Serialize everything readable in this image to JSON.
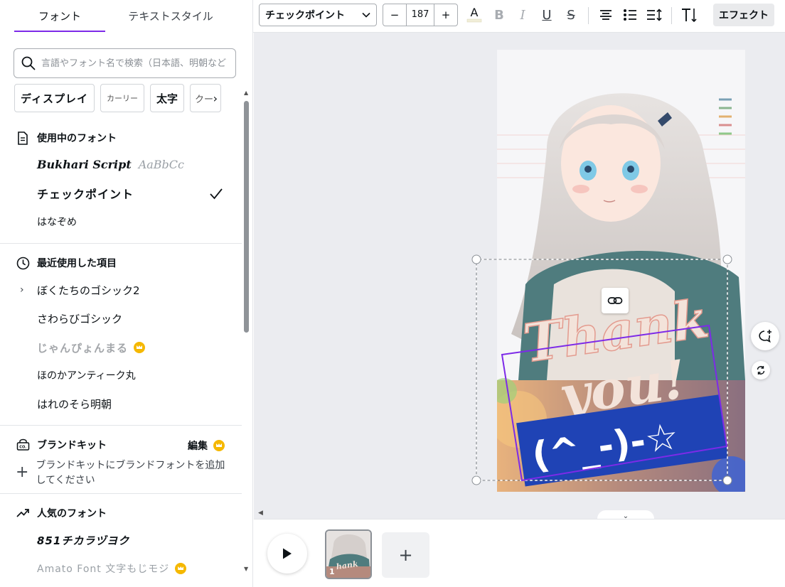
{
  "tabs": {
    "fonts": "フォント",
    "text_styles": "テキストスタイル"
  },
  "search": {
    "placeholder": "言語やフォント名で検索（日本語、明朝など）"
  },
  "chips": [
    "ディスプレイ",
    "カーリー",
    "太字",
    "クー"
  ],
  "sections": {
    "in_use": {
      "title": "使用中のフォント",
      "items": [
        {
          "name": "Bukhari Script",
          "sample": "AaBbCc"
        },
        {
          "name": "チェックポイント",
          "selected": true
        },
        {
          "name": "はなぞめ"
        }
      ]
    },
    "recent": {
      "title": "最近使用した項目",
      "items": [
        {
          "name": "ぼくたちのゴシック2",
          "expandable": true
        },
        {
          "name": "さわらびゴシック"
        },
        {
          "name": "じゃんぴょんまる",
          "pro": true
        },
        {
          "name": "ほのかアンティーク丸"
        },
        {
          "name": "はれのそら明朝"
        }
      ]
    },
    "brand": {
      "title": "ブランドキット",
      "edit": "編集",
      "add_text": "ブランドキットにブランドフォントを追加してください"
    },
    "popular": {
      "title": "人気のフォント",
      "items": [
        {
          "name": "851チカラヅヨク"
        },
        {
          "name": "Amato Font 文字もじモジ",
          "pro": true
        }
      ]
    }
  },
  "toolbar": {
    "font_name": "チェックポイント",
    "font_size": "187",
    "minus": "−",
    "plus": "+",
    "color_letter": "A",
    "bold": "B",
    "italic": "I",
    "underline": "U",
    "strike": "S",
    "effects": "エフェクト"
  },
  "canvas": {
    "text_line1": "Thank",
    "text_line2": "you!",
    "kaomoji": "(^_-)-☆",
    "colors": {
      "accent": "#7d2ae8",
      "banner": "#1f43b5",
      "text": "#f3e3da"
    }
  },
  "bottom": {
    "page_number": "1",
    "add": "+"
  }
}
